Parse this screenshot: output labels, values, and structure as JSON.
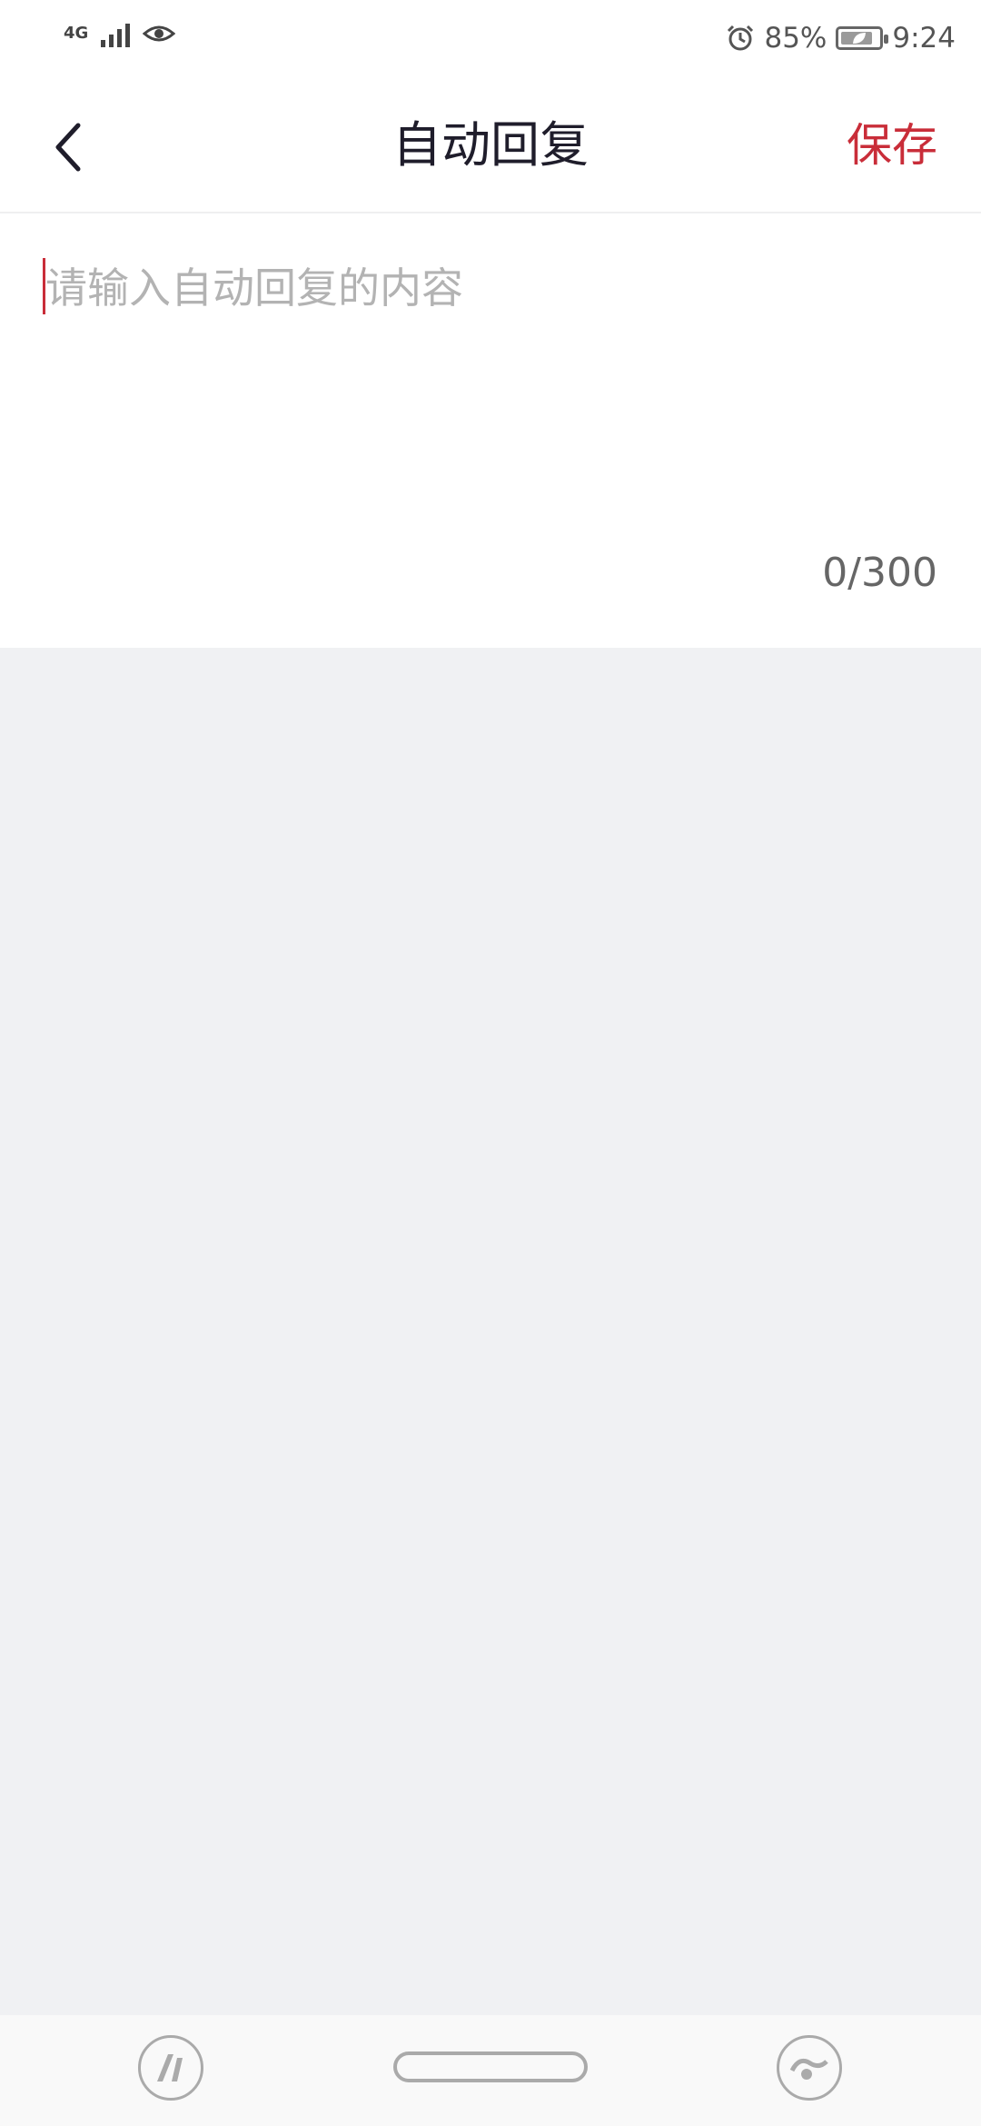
{
  "status_bar": {
    "network": "4G",
    "battery_percent": "85%",
    "battery_level": 0.85,
    "time": "9:24",
    "icons": [
      "signal-icon",
      "eye-icon",
      "alarm-icon",
      "battery-icon"
    ]
  },
  "header": {
    "back_icon": "chevron-left-icon",
    "title": "自动回复",
    "save_label": "保存"
  },
  "editor": {
    "placeholder": "请输入自动回复的内容",
    "value": "",
    "counter": "0/300"
  },
  "colors": {
    "accent": "#c92d39",
    "background": "#f0f1f3",
    "surface": "#ffffff"
  },
  "nav_bar": {
    "icons": [
      "assistant-icon",
      "home-pill",
      "smart-icon"
    ]
  }
}
